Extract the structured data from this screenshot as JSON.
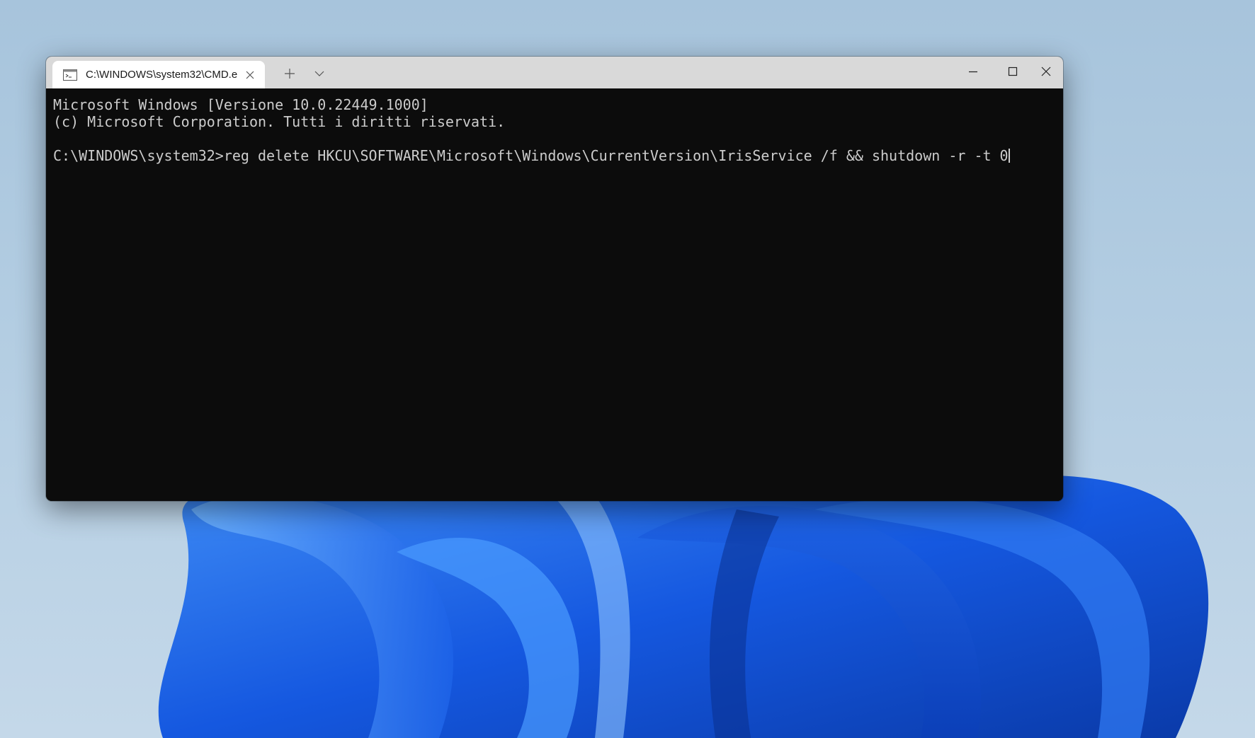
{
  "window": {
    "tab_title": "C:\\WINDOWS\\system32\\CMD.e",
    "icons": {
      "tab": "cmd-icon",
      "close_tab": "close-icon",
      "new_tab": "plus-icon",
      "dropdown": "chevron-down-icon",
      "minimize": "minimize-icon",
      "maximize": "maximize-icon",
      "close": "close-icon"
    }
  },
  "console": {
    "lines": [
      "Microsoft Windows [Versione 10.0.22449.1000]",
      "(c) Microsoft Corporation. Tutti i diritti riservati.",
      ""
    ],
    "prompt": "C:\\WINDOWS\\system32>",
    "command": "reg delete HKCU\\SOFTWARE\\Microsoft\\Windows\\CurrentVersion\\IrisService /f && shutdown -r -t 0"
  },
  "colors": {
    "console_bg": "#0c0c0c",
    "console_fg": "#cccccc",
    "titlebar_bg": "#d9d9d9",
    "tab_bg": "#ffffff",
    "wallpaper_bloom": "#1a5fe0"
  }
}
